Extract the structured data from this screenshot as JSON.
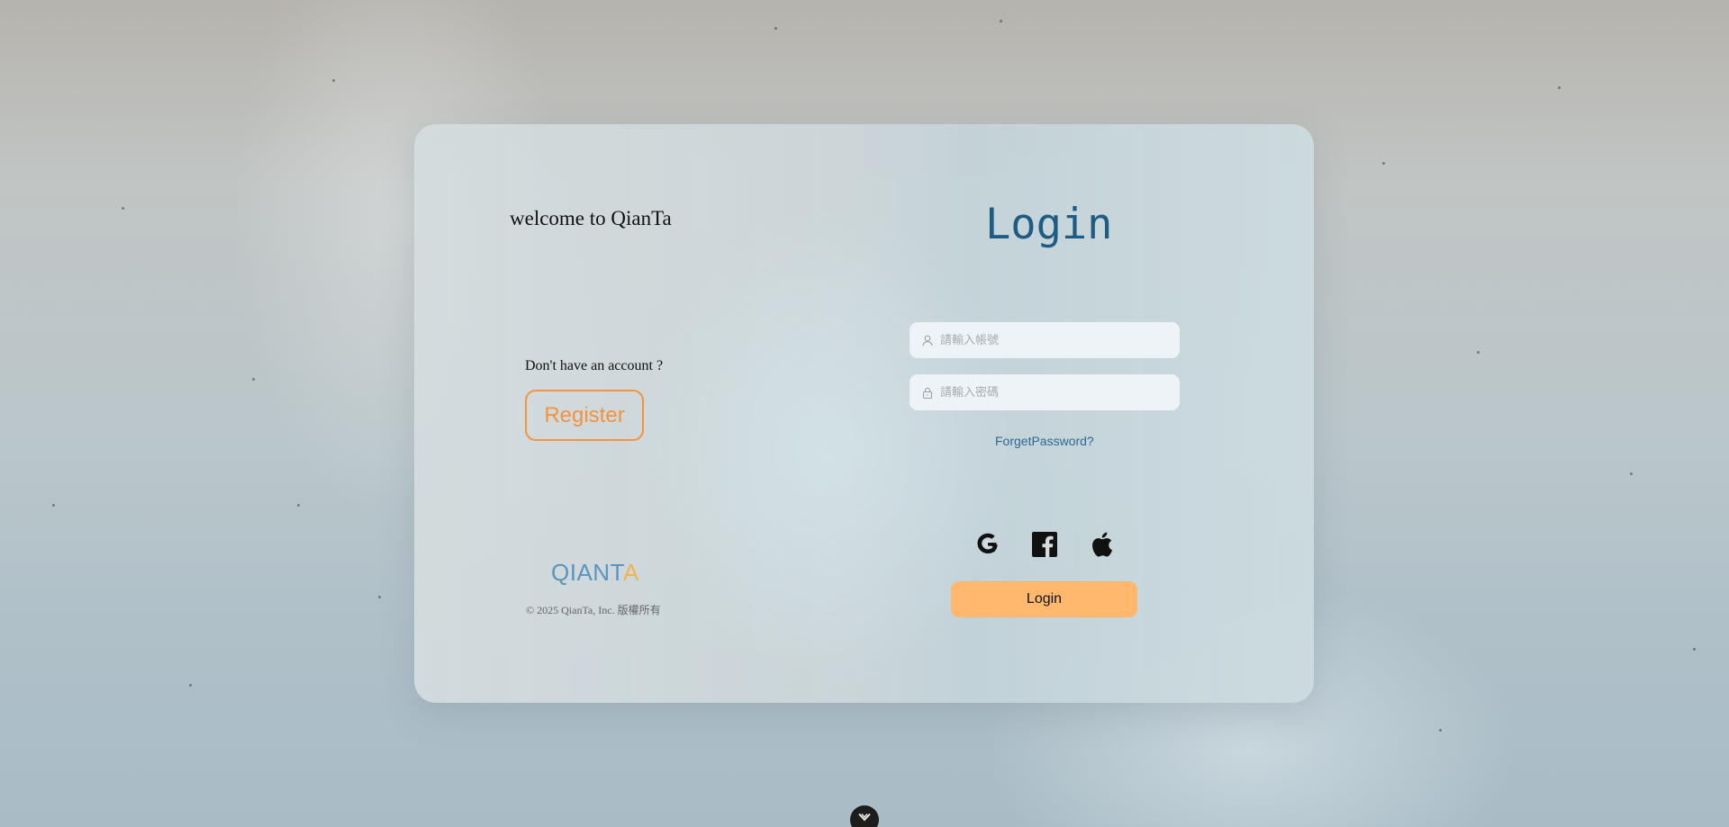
{
  "welcome": {
    "title": "welcome to QianTa"
  },
  "register_panel": {
    "prompt": "Don't have an account ?",
    "register_label": "Register"
  },
  "brand": {
    "logo_main": "QIANT",
    "logo_accent": "A",
    "copyright": "© 2025 QianTa, Inc. 版權所有"
  },
  "login_panel": {
    "title": "Login",
    "account_placeholder": "請輸入帳號",
    "account_value": "",
    "password_placeholder": "請輸入密碼",
    "password_value": "",
    "forgot_label": "ForgetPassword?",
    "social_icons": [
      "google-icon",
      "facebook-icon",
      "apple-icon"
    ],
    "login_label": "Login"
  },
  "colors": {
    "accent_orange": "#f5923e",
    "login_button": "#ffb86e",
    "title_blue": "#1f5c84",
    "brand_blue": "#5b94bd",
    "brand_yellow": "#f0b54a"
  }
}
